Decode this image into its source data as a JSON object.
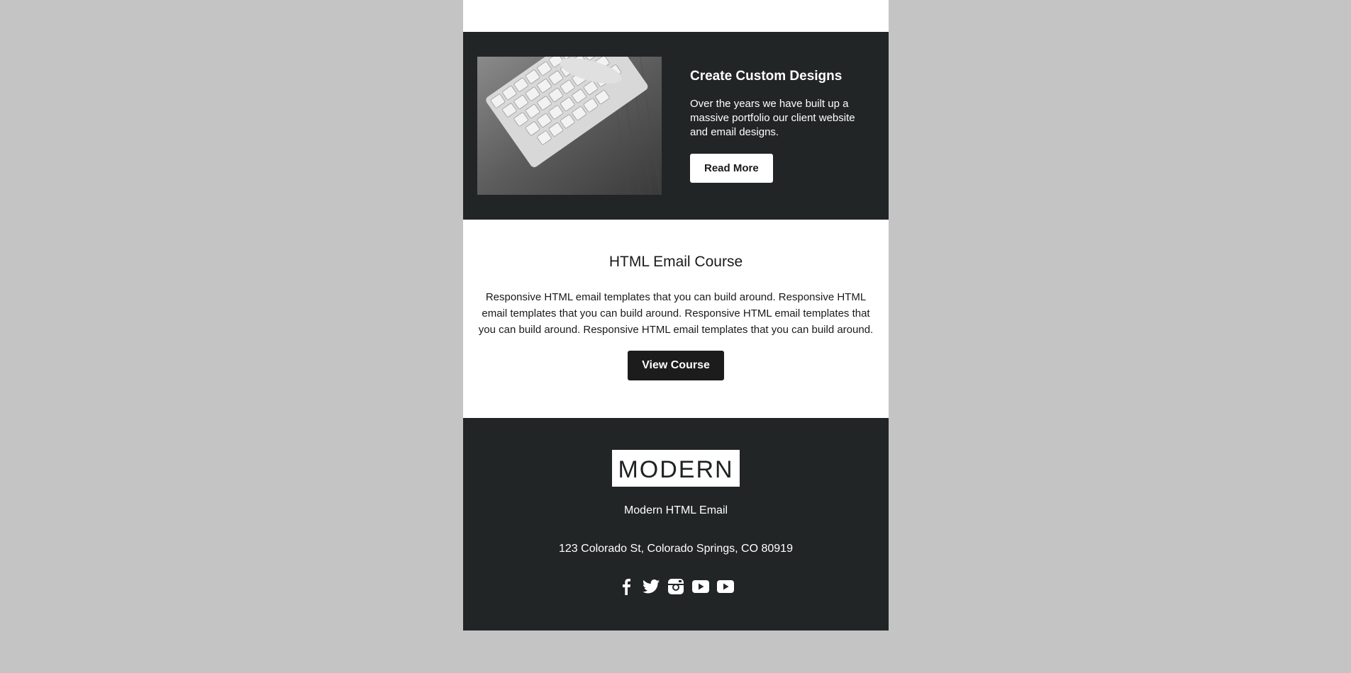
{
  "promo": {
    "title": "Create Custom Designs",
    "body": "Over the years we have built up a massive portfolio our client website and email designs.",
    "button_label": "Read More"
  },
  "course": {
    "title": "HTML Email Course",
    "body": "Responsive HTML email templates that you can build around. Responsive HTML email templates that you can build around. Responsive HTML email templates that you can build around. Responsive HTML email templates that you can build around.",
    "button_label": "View Course"
  },
  "footer": {
    "logo_text": "MODERN",
    "name": "Modern HTML Email",
    "address": "123 Colorado St, Colorado Springs, CO 80919",
    "social_icons": [
      "facebook-icon",
      "twitter-icon",
      "instagram-icon",
      "youtube-icon",
      "youtube-icon"
    ]
  },
  "colors": {
    "page_background": "#c4c4c4",
    "dark_section": "#222526",
    "button_dark": "#1c1c1c",
    "white": "#ffffff"
  }
}
